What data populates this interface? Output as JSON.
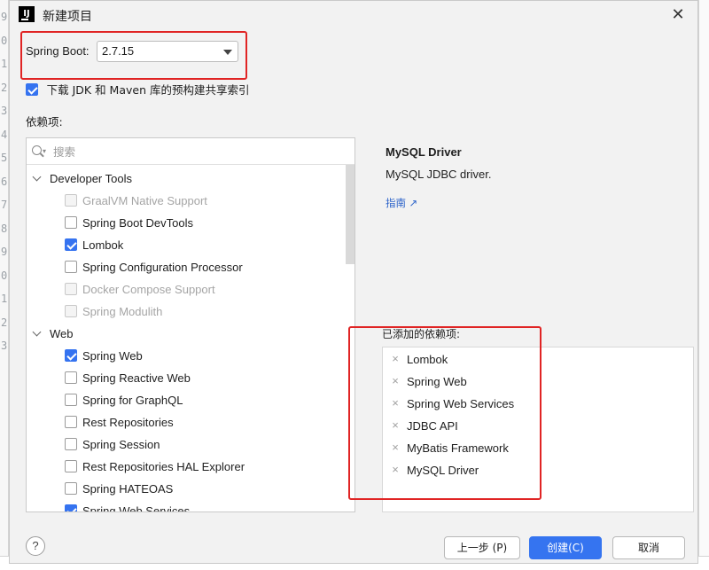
{
  "window": {
    "title": "新建项目",
    "close_icon": "close-icon"
  },
  "spring_boot": {
    "label": "Spring Boot:",
    "selected_version": "2.7.15"
  },
  "download_index": {
    "checked": true,
    "label": "下载 JDK 和 Maven 库的预构建共享索引"
  },
  "dependencies": {
    "section_label": "依赖项:",
    "search_placeholder": "搜索",
    "categories": [
      {
        "name": "Developer Tools",
        "items": [
          {
            "label": "GraalVM Native Support",
            "checked": false,
            "disabled": true
          },
          {
            "label": "Spring Boot DevTools",
            "checked": false,
            "disabled": false
          },
          {
            "label": "Lombok",
            "checked": true,
            "disabled": false
          },
          {
            "label": "Spring Configuration Processor",
            "checked": false,
            "disabled": false
          },
          {
            "label": "Docker Compose Support",
            "checked": false,
            "disabled": true
          },
          {
            "label": "Spring Modulith",
            "checked": false,
            "disabled": true
          }
        ]
      },
      {
        "name": "Web",
        "items": [
          {
            "label": "Spring Web",
            "checked": true,
            "disabled": false
          },
          {
            "label": "Spring Reactive Web",
            "checked": false,
            "disabled": false
          },
          {
            "label": "Spring for GraphQL",
            "checked": false,
            "disabled": false
          },
          {
            "label": "Rest Repositories",
            "checked": false,
            "disabled": false
          },
          {
            "label": "Spring Session",
            "checked": false,
            "disabled": false
          },
          {
            "label": "Rest Repositories HAL Explorer",
            "checked": false,
            "disabled": false
          },
          {
            "label": "Spring HATEOAS",
            "checked": false,
            "disabled": false
          },
          {
            "label": "Spring Web Services",
            "checked": true,
            "disabled": false
          }
        ]
      }
    ]
  },
  "detail": {
    "title": "MySQL Driver",
    "description": "MySQL JDBC driver.",
    "guide_link": "指南 ↗"
  },
  "added": {
    "label": "已添加的依赖项:",
    "items": [
      "Lombok",
      "Spring Web",
      "Spring Web Services",
      "JDBC API",
      "MyBatis Framework",
      "MySQL Driver"
    ]
  },
  "buttons": {
    "help": "?",
    "previous": "上一步 (P)",
    "create": "创建(C)",
    "cancel": "取消"
  },
  "background_editor": {
    "line_numbers": [
      "9",
      "0",
      "1",
      "2",
      "3",
      "4",
      "5",
      "6",
      "7",
      "8",
      "9",
      "0",
      "1",
      "2",
      "3"
    ]
  },
  "colors": {
    "accent": "#3574f0",
    "highlight_box": "#e02424"
  }
}
